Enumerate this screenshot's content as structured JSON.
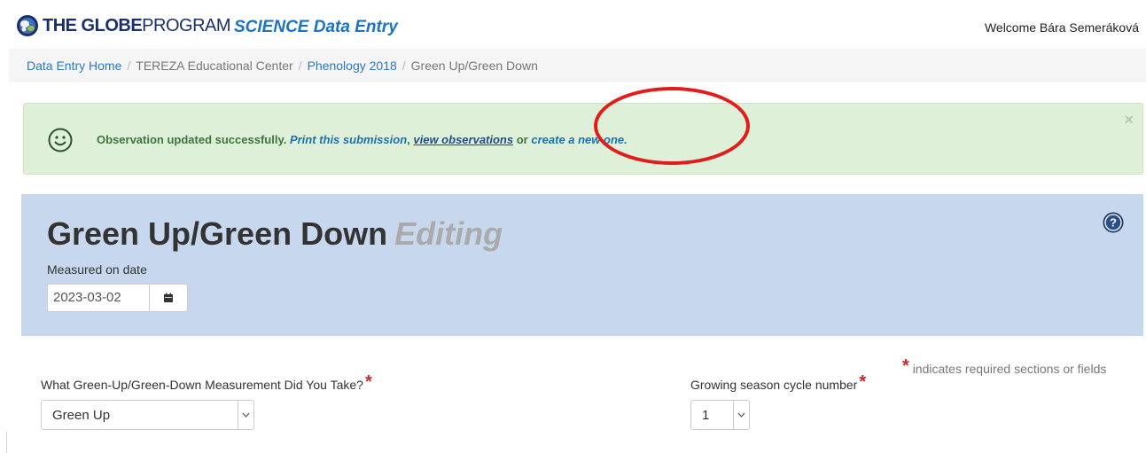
{
  "header": {
    "logo_text_bold": "THE GLOBE",
    "logo_text_light": "PROGRAM",
    "app_title": "SCIENCE Data Entry",
    "welcome": "Welcome Bára Semeráková"
  },
  "breadcrumb": {
    "items": [
      {
        "label": "Data Entry Home",
        "link": true
      },
      {
        "label": "TEREZA Educational Center",
        "link": false
      },
      {
        "label": "Phenology 2018",
        "link": true
      },
      {
        "label": "Green Up/Green Down",
        "link": false
      }
    ],
    "separator": "/"
  },
  "alert": {
    "message": "Observation updated successfully.",
    "print_link": "Print this submission",
    "comma": ",",
    "view_link": "view observations",
    "or_text": "or",
    "create_link": "create a new one.",
    "close": "×",
    "color_bg": "#dff0d8",
    "color_text": "#3c763d"
  },
  "panel": {
    "title": "Green Up/Green Down",
    "mode": "Editing",
    "date_label": "Measured on date",
    "date_value": "2023-03-02",
    "color_bg": "#c7d8ee"
  },
  "form": {
    "required_note": "indicates required sections or fields",
    "required_star": "*",
    "measurement_label": "What Green-Up/Green-Down Measurement Did You Take?",
    "measurement_value": "Green Up",
    "cycle_label": "Growing season cycle number",
    "cycle_value": "1"
  },
  "icons": {
    "logo": "globe-icon",
    "smiley": "smiley-icon",
    "help": "help-icon",
    "calendar": "calendar-icon",
    "dropdown": "chevron-down-icon"
  },
  "annotation_color": "#e31b1b"
}
